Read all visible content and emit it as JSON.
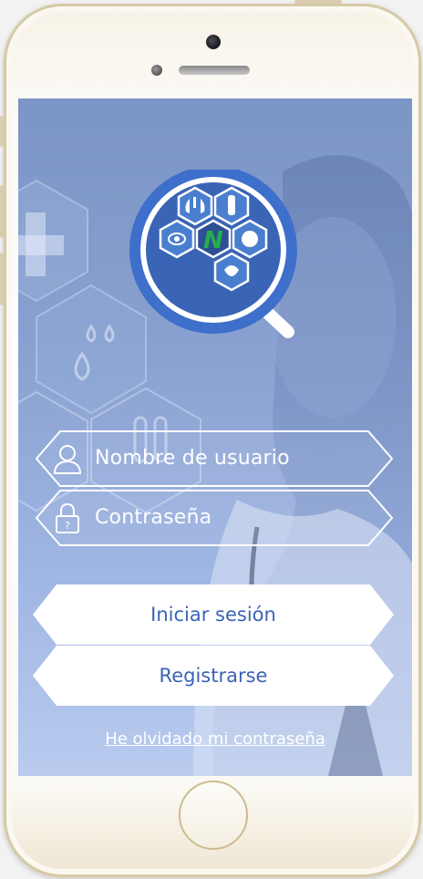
{
  "login": {
    "username_placeholder": "Nombre de usuario",
    "password_placeholder": "Contraseña",
    "login_button": "Iniciar sesión",
    "register_button": "Registrarse",
    "forgot_password_link": "He olvidado mi contraseña"
  },
  "logo": {
    "letter": "N"
  },
  "icons": {
    "user": "user-icon",
    "lock": "lock-icon",
    "lock_glyph": "?"
  },
  "colors": {
    "accent_blue": "#3b63b6",
    "logo_ring": "#3d6fcb",
    "logo_green": "#22b04a",
    "overlay": "#7b95c7",
    "frame_gold": "#d6c9a6"
  }
}
